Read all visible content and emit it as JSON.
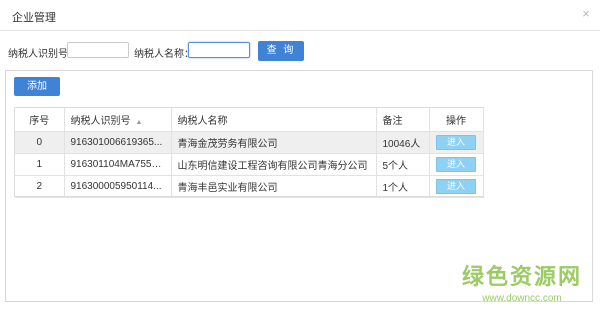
{
  "dialog": {
    "title": "企业管理",
    "close_symbol": "×"
  },
  "search": {
    "taxpayer_id_label": "纳税人识别号：",
    "taxpayer_id_value": "",
    "taxpayer_name_label": "纳税人名称：",
    "taxpayer_name_value": "",
    "query_button": "查 询"
  },
  "toolbar": {
    "add_button": "添加"
  },
  "table": {
    "headers": {
      "index": "序号",
      "taxpayer_id": "纳税人识别号",
      "taxpayer_name": "纳税人名称",
      "remark": "备注",
      "action": "操作"
    },
    "sort_icon": "▲",
    "rows": [
      {
        "index": "0",
        "taxpayer_id": "916301006619365...",
        "taxpayer_name": "青海金茂劳务有限公司",
        "remark": "10046人",
        "action": "进入"
      },
      {
        "index": "1",
        "taxpayer_id": "916301104MA7551...",
        "taxpayer_name": "山东明信建设工程咨询有限公司青海分公司",
        "remark": "5个人",
        "action": "进入"
      },
      {
        "index": "2",
        "taxpayer_id": "916300005950114...",
        "taxpayer_name": "青海丰邑实业有限公司",
        "remark": "1个人",
        "action": "进入"
      }
    ]
  },
  "watermark": {
    "text": "绿色资源网",
    "url": "www.downcc.com"
  }
}
